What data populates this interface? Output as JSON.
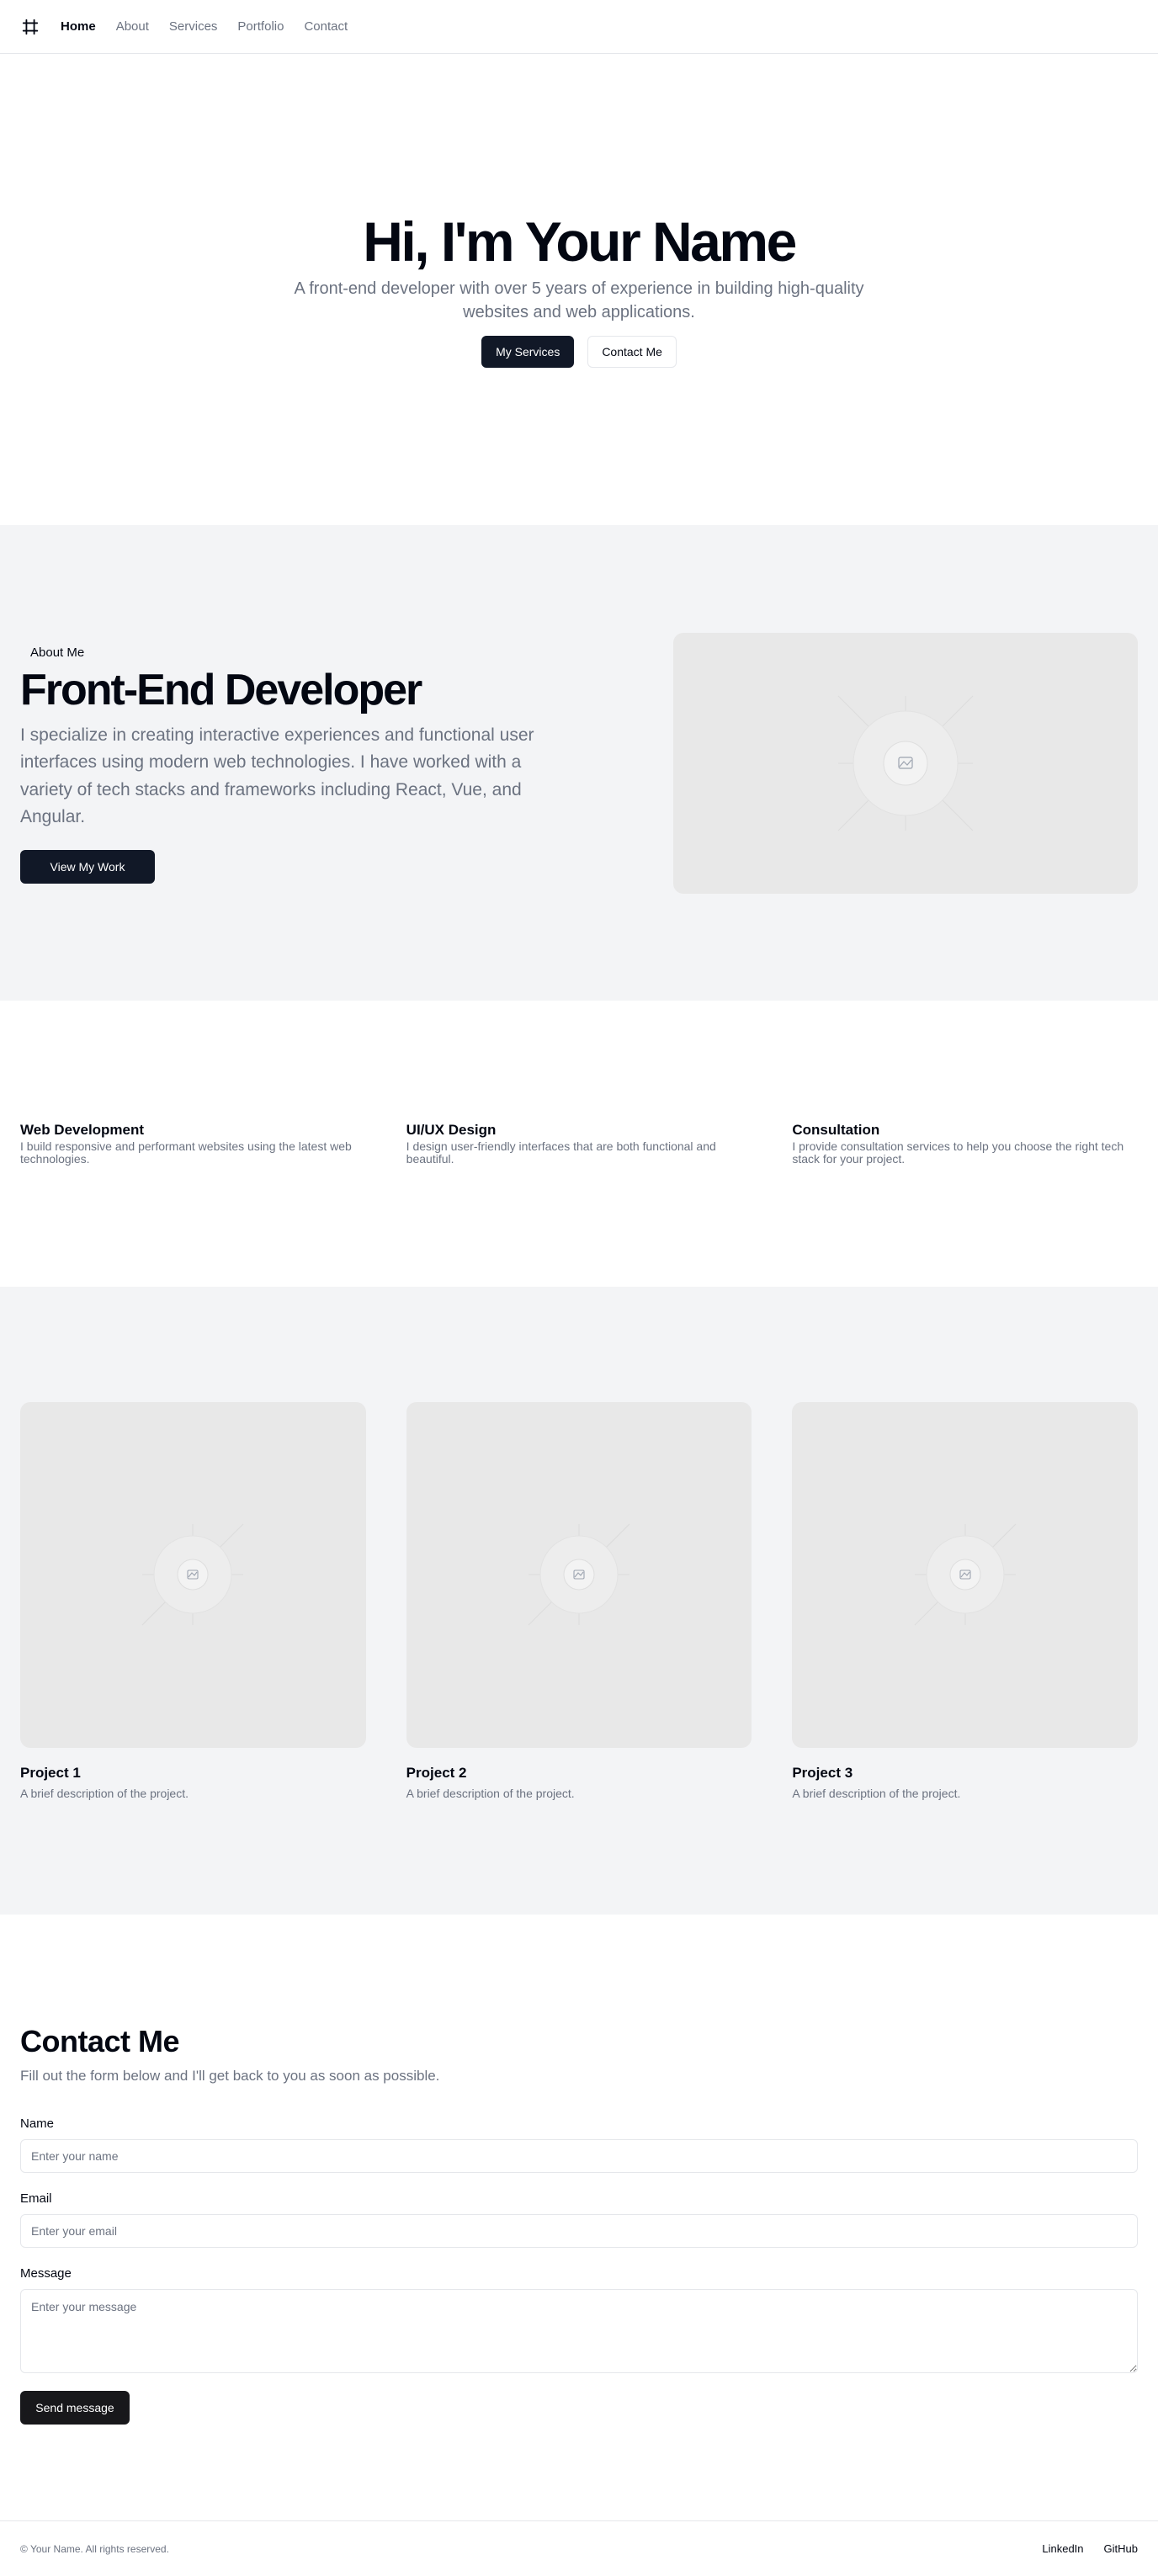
{
  "nav": {
    "logo_icon": "grid-hash-icon",
    "items": [
      {
        "label": "Home",
        "active": true
      },
      {
        "label": "About",
        "active": false
      },
      {
        "label": "Services",
        "active": false
      },
      {
        "label": "Portfolio",
        "active": false
      },
      {
        "label": "Contact",
        "active": false
      }
    ]
  },
  "hero": {
    "title": "Hi, I'm Your Name",
    "subtitle": "A front-end developer with over 5 years of experience in building high-quality websites and web applications.",
    "primary_button": "My Services",
    "secondary_button": "Contact Me"
  },
  "about": {
    "eyebrow": "About Me",
    "title": "Front-End Developer",
    "body": "I specialize in creating interactive experiences and functional user interfaces using modern web technologies. I have worked with a variety of tech stacks and frameworks including React, Vue, and Angular.",
    "button": "View My Work",
    "image_icon": "image-placeholder-icon"
  },
  "services": [
    {
      "title": "Web Development",
      "description": "I build responsive and performant websites using the latest web technologies."
    },
    {
      "title": "UI/UX Design",
      "description": "I design user-friendly interfaces that are both functional and beautiful."
    },
    {
      "title": "Consultation",
      "description": "I provide consultation services to help you choose the right tech stack for your project."
    }
  ],
  "portfolio": [
    {
      "title": "Project 1",
      "description": "A brief description of the project."
    },
    {
      "title": "Project 2",
      "description": "A brief description of the project."
    },
    {
      "title": "Project 3",
      "description": "A brief description of the project."
    }
  ],
  "contact": {
    "title": "Contact Me",
    "subtitle": "Fill out the form below and I'll get back to you as soon as possible.",
    "name_label": "Name",
    "name_placeholder": "Enter your name",
    "email_label": "Email",
    "email_placeholder": "Enter your email",
    "message_label": "Message",
    "message_placeholder": "Enter your message",
    "submit": "Send message"
  },
  "footer": {
    "copyright": "© Your Name. All rights reserved.",
    "links": [
      "LinkedIn",
      "GitHub"
    ]
  },
  "colors": {
    "primary": "#111827",
    "muted_text": "#6b7280",
    "section_bg": "#f3f4f6",
    "placeholder_bg": "#e8e8e8",
    "border": "#e5e7eb"
  }
}
